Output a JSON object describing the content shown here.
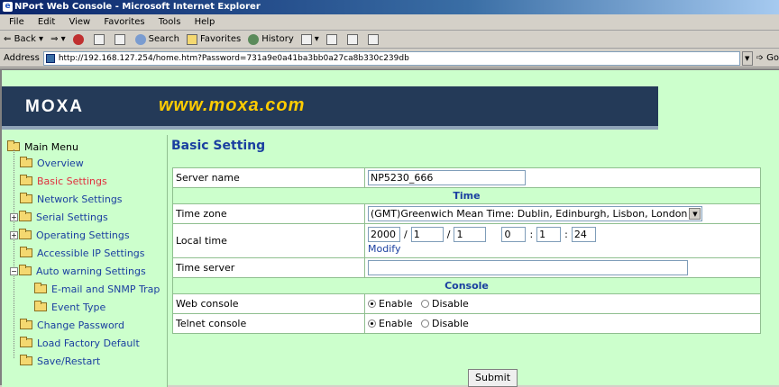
{
  "browser": {
    "title": "NPort Web Console - Microsoft Internet Explorer",
    "menu": [
      "File",
      "Edit",
      "View",
      "Favorites",
      "Tools",
      "Help"
    ],
    "toolbar": {
      "back": "Back",
      "search": "Search",
      "favorites": "Favorites",
      "history": "History"
    },
    "address_label": "Address",
    "address_value": "http://192.168.127.254/home.htm?Password=731a9e0a41ba3bb0a27ca8b330c239db",
    "go_label": "Go"
  },
  "banner": {
    "logo": "MOXA",
    "url": "www.moxa.com"
  },
  "sidebar": {
    "root": "Main Menu",
    "items": [
      {
        "label": "Overview"
      },
      {
        "label": "Basic Settings"
      },
      {
        "label": "Network Settings"
      },
      {
        "label": "Serial Settings"
      },
      {
        "label": "Operating Settings"
      },
      {
        "label": "Accessible IP Settings"
      },
      {
        "label": "Auto warning Settings"
      },
      {
        "label": "E-mail and SNMP Trap"
      },
      {
        "label": "Event Type"
      },
      {
        "label": "Change Password"
      },
      {
        "label": "Load Factory Default"
      },
      {
        "label": "Save/Restart"
      }
    ]
  },
  "page": {
    "title": "Basic Setting",
    "server_name_label": "Server name",
    "server_name_value": "NP5230_666",
    "time_section": "Time",
    "time_zone_label": "Time zone",
    "time_zone_value": "(GMT)Greenwich Mean Time: Dublin, Edinburgh, Lisbon, London",
    "local_time_label": "Local time",
    "local_time": {
      "year": "2000",
      "month": "1",
      "day": "1",
      "hour": "0",
      "minute": "1",
      "second": "24",
      "date_sep": "/",
      "time_sep": ":"
    },
    "modify_label": "Modify",
    "time_server_label": "Time server",
    "time_server_value": "",
    "console_section": "Console",
    "web_console_label": "Web console",
    "telnet_console_label": "Telnet console",
    "enable_label": "Enable",
    "disable_label": "Disable",
    "web_console_selected": "Enable",
    "telnet_console_selected": "Enable",
    "submit_label": "Submit"
  },
  "colors": {
    "page_bg": "#ccffcc",
    "banner_bg": "#243a58",
    "link": "#1a3fa0",
    "active": "#e0303e",
    "url_text": "#ffcc00"
  }
}
